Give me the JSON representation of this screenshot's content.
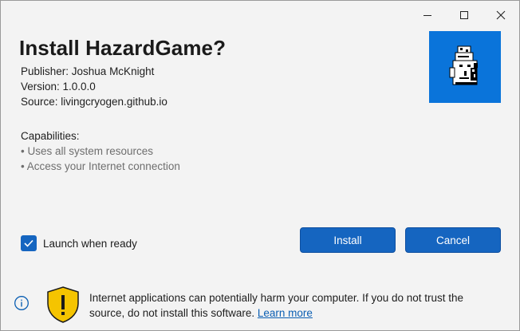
{
  "window": {
    "controls": {
      "minimize_icon": "minimize-icon",
      "maximize_icon": "maximize-icon",
      "close_icon": "close-icon"
    }
  },
  "app": {
    "title": "Install HazardGame?",
    "publisher": "Publisher: Joshua McKnight",
    "version": "Version: 1.0.0.0",
    "source": "Source: livingcryogen.github.io",
    "logo_icon": "pixel-art-character-icon",
    "logo_bg": "#0a74da"
  },
  "capabilities": {
    "heading": "Capabilities:",
    "items": [
      "Uses all system resources",
      "Access your Internet connection"
    ]
  },
  "launch": {
    "label": "Launch when ready",
    "checked": true
  },
  "buttons": {
    "install": "Install",
    "cancel": "Cancel"
  },
  "footer": {
    "warning": "Internet applications can potentially harm your computer. If you do not trust the source, do not install this software.",
    "learn_more": "Learn more",
    "icons": [
      "info-icon",
      "warning-shield-icon"
    ]
  },
  "colors": {
    "accent": "#1565c0",
    "link": "#0b5fb3",
    "shield": "#f5c400"
  }
}
